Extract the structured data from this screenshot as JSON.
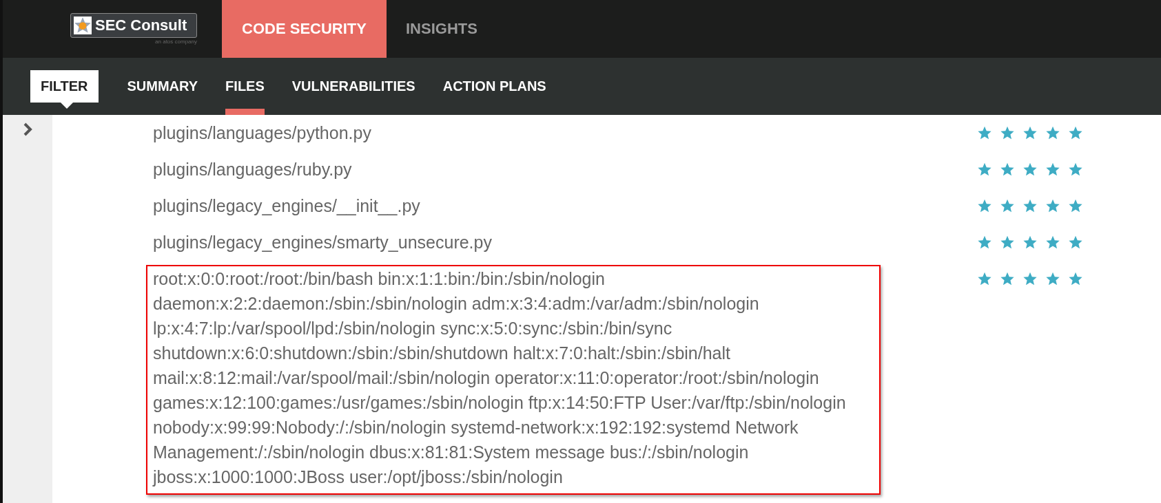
{
  "logo": {
    "name": "SEC Consult",
    "tagline": "an atos company"
  },
  "main_tabs": [
    {
      "label": "CODE SECURITY",
      "selected": true
    },
    {
      "label": "INSIGHTS",
      "selected": false
    }
  ],
  "filter": {
    "label": "FILTER"
  },
  "sub_tabs": [
    {
      "label": "SUMMARY",
      "selected": false
    },
    {
      "label": "FILES",
      "selected": true
    },
    {
      "label": "VULNERABILITIES",
      "selected": false
    },
    {
      "label": "ACTION PLANS",
      "selected": false
    }
  ],
  "files": [
    {
      "lines": [
        "plugins/languages/python.py"
      ],
      "highlighted": false,
      "stars": 5
    },
    {
      "lines": [
        "plugins/languages/ruby.py"
      ],
      "highlighted": false,
      "stars": 5
    },
    {
      "lines": [
        "plugins/legacy_engines/__init__.py"
      ],
      "highlighted": false,
      "stars": 5
    },
    {
      "lines": [
        "plugins/legacy_engines/smarty_unsecure.py"
      ],
      "highlighted": false,
      "stars": 5
    },
    {
      "lines": [
        "root:x:0:0:root:/root:/bin/bash bin:x:1:1:bin:/bin:/sbin/nologin",
        "daemon:x:2:2:daemon:/sbin:/sbin/nologin adm:x:3:4:adm:/var/adm:/sbin/nologin",
        "lp:x:4:7:lp:/var/spool/lpd:/sbin/nologin sync:x:5:0:sync:/sbin:/bin/sync",
        "shutdown:x:6:0:shutdown:/sbin:/sbin/shutdown halt:x:7:0:halt:/sbin:/sbin/halt",
        "mail:x:8:12:mail:/var/spool/mail:/sbin/nologin operator:x:11:0:operator:/root:/sbin/nologin",
        "games:x:12:100:games:/usr/games:/sbin/nologin ftp:x:14:50:FTP User:/var/ftp:/sbin/nologin",
        "nobody:x:99:99:Nobody:/:/sbin/nologin systemd-network:x:192:192:systemd Network",
        "Management:/:/sbin/nologin dbus:x:81:81:System message bus:/:/sbin/nologin",
        "jboss:x:1000:1000:JBoss user:/opt/jboss:/sbin/nologin"
      ],
      "highlighted": true,
      "stars": 5
    }
  ]
}
